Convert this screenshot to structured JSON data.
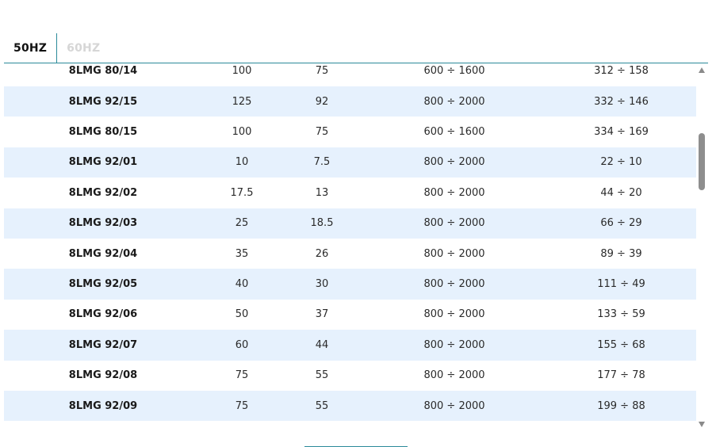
{
  "tabs": [
    {
      "label": "50HZ",
      "active": true
    },
    {
      "label": "60HZ",
      "active": false
    }
  ],
  "rows": [
    {
      "model": "8LMG 80/14",
      "kw": "100",
      "hp": "75",
      "range": "600 ÷ 1600",
      "head": "312 ÷ 158"
    },
    {
      "model": "8LMG 92/15",
      "kw": "125",
      "hp": "92",
      "range": "800 ÷ 2000",
      "head": "332 ÷ 146"
    },
    {
      "model": "8LMG 80/15",
      "kw": "100",
      "hp": "75",
      "range": "600 ÷ 1600",
      "head": "334 ÷ 169"
    },
    {
      "model": "8LMG 92/01",
      "kw": "10",
      "hp": "7.5",
      "range": "800 ÷ 2000",
      "head": "22 ÷ 10"
    },
    {
      "model": "8LMG 92/02",
      "kw": "17.5",
      "hp": "13",
      "range": "800 ÷ 2000",
      "head": "44 ÷ 20"
    },
    {
      "model": "8LMG 92/03",
      "kw": "25",
      "hp": "18.5",
      "range": "800 ÷ 2000",
      "head": "66 ÷ 29"
    },
    {
      "model": "8LMG 92/04",
      "kw": "35",
      "hp": "26",
      "range": "800 ÷ 2000",
      "head": "89 ÷ 39"
    },
    {
      "model": "8LMG 92/05",
      "kw": "40",
      "hp": "30",
      "range": "800 ÷ 2000",
      "head": "111 ÷ 49"
    },
    {
      "model": "8LMG 92/06",
      "kw": "50",
      "hp": "37",
      "range": "800 ÷ 2000",
      "head": "133 ÷ 59"
    },
    {
      "model": "8LMG 92/07",
      "kw": "60",
      "hp": "44",
      "range": "800 ÷ 2000",
      "head": "155 ÷ 68"
    },
    {
      "model": "8LMG 92/08",
      "kw": "75",
      "hp": "55",
      "range": "800 ÷ 2000",
      "head": "177 ÷ 78"
    },
    {
      "model": "8LMG 92/09",
      "kw": "75",
      "hp": "55",
      "range": "800 ÷ 2000",
      "head": "199 ÷ 88"
    }
  ],
  "colors": {
    "accent": "#2b8a9a",
    "row_alt": "#e6f1fd",
    "tab_inactive": "#d6d6d6"
  }
}
